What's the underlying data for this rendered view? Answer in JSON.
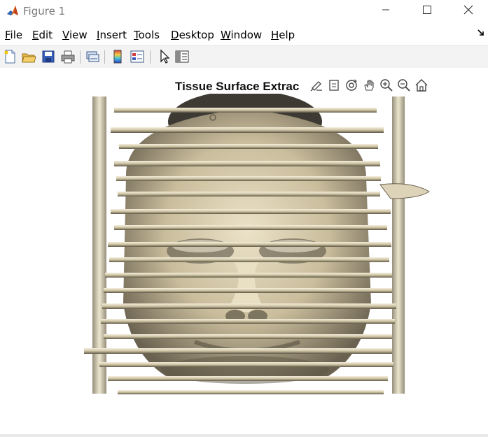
{
  "window": {
    "title": "Figure 1",
    "app_icon": "matlab-icon",
    "controls": [
      "minimize-icon",
      "maximize-icon",
      "close-icon"
    ]
  },
  "menu": {
    "items": [
      {
        "label": "File",
        "accel": "F",
        "rest": "ile"
      },
      {
        "label": "Edit",
        "accel": "E",
        "rest": "dit"
      },
      {
        "label": "View",
        "accel": "V",
        "rest": "iew"
      },
      {
        "label": "Insert",
        "accel": "I",
        "rest": "nsert"
      },
      {
        "label": "Tools",
        "accel": "T",
        "rest": "ools"
      },
      {
        "label": "Desktop",
        "accel": "D",
        "rest": "esktop"
      },
      {
        "label": "Window",
        "accel": "W",
        "rest": "indow"
      },
      {
        "label": "Help",
        "accel": "H",
        "rest": "elp"
      }
    ],
    "dock_icon": "dock-arrow-icon"
  },
  "toolbar": {
    "buttons": [
      "new-figure-icon",
      "open-file-icon",
      "save-icon",
      "print-icon",
      "link-plot-icon",
      "colorbar-icon",
      "legend-icon",
      "edit-plot-icon",
      "property-inspector-icon"
    ]
  },
  "axes": {
    "title": "Tissue Surface Extrac",
    "tools": [
      "brush-icon",
      "data-tips-icon",
      "rotate-3d-icon",
      "pan-icon",
      "zoom-in-icon",
      "zoom-out-icon",
      "restore-view-icon"
    ]
  },
  "render": {
    "subject": "3-D rendered head surface (isosurface) with horizontal slice artifacts",
    "surface_color": "#d8cdb0",
    "shadow_color": "#5e5746"
  }
}
